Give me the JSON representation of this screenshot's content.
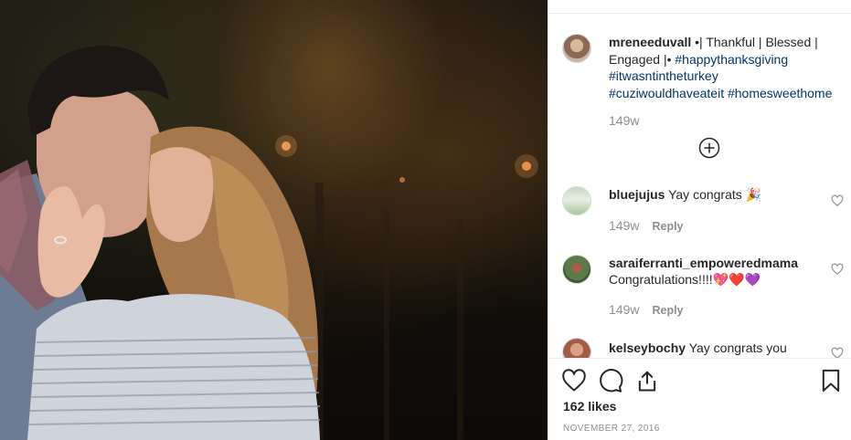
{
  "post": {
    "author": "mreneeduvall",
    "caption_text": " •| Thankful | Blessed | Engaged |• ",
    "hashtags": [
      "#happythanksgiving",
      "#itwasntintheturkey",
      "#cuziwouldhaveateit",
      "#homesweethome"
    ],
    "caption_age": "149w"
  },
  "comments": [
    {
      "username": "bluejujus",
      "text": "Yay congrats 🎉",
      "age": "149w",
      "reply_label": "Reply"
    },
    {
      "username": "saraiferranti_empoweredmama",
      "text": "Congratulations!!!!💖❤️💜",
      "age": "149w",
      "reply_label": "Reply"
    },
    {
      "username": "kelseybochy",
      "text": "Yay congrats you"
    }
  ],
  "footer": {
    "likes": "162 likes",
    "date": "NOVEMBER 27, 2016"
  },
  "icons": {
    "like": "heart-icon",
    "comment": "comment-icon",
    "share": "share-icon",
    "save": "bookmark-icon",
    "load_more": "plus-circle-icon",
    "comment_like": "small-heart-icon"
  },
  "colors": {
    "text": "#262626",
    "muted": "#8e8e8e",
    "hashtag": "#003569",
    "border": "#efefef"
  }
}
